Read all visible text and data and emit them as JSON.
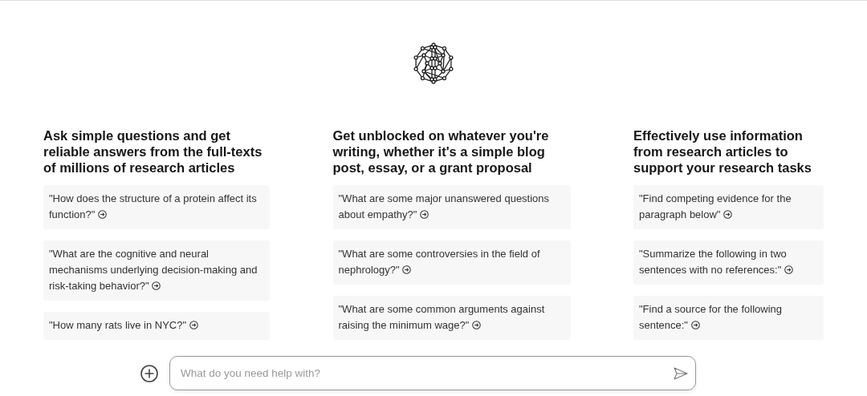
{
  "columns": [
    {
      "heading": "Ask simple questions and get reliable answers from the full-texts of millions of research articles",
      "prompts": [
        "\"How does the structure of a protein affect its function?\"",
        "\"What are the cognitive and neural mechanisms underlying decision-making and risk-taking behavior?\"",
        "\"How many rats live in NYC?\""
      ]
    },
    {
      "heading": "Get unblocked on whatever you're writing, whether it's a simple blog post, essay, or a grant proposal",
      "prompts": [
        "\"What are some major unanswered questions about empathy?\"",
        "\"What are some controversies in the field of nephrology?\"",
        "\"What are some common arguments against raising the minimum wage?\""
      ]
    },
    {
      "heading": "Effectively use information from research articles to support your research tasks",
      "prompts": [
        "\"Find competing evidence for the paragraph below\"",
        "\"Summarize the following in two sentences with no references:\"",
        "\"Find a source for the following sentence:\""
      ]
    }
  ],
  "chat_input": {
    "placeholder": "What do you need help with?"
  }
}
